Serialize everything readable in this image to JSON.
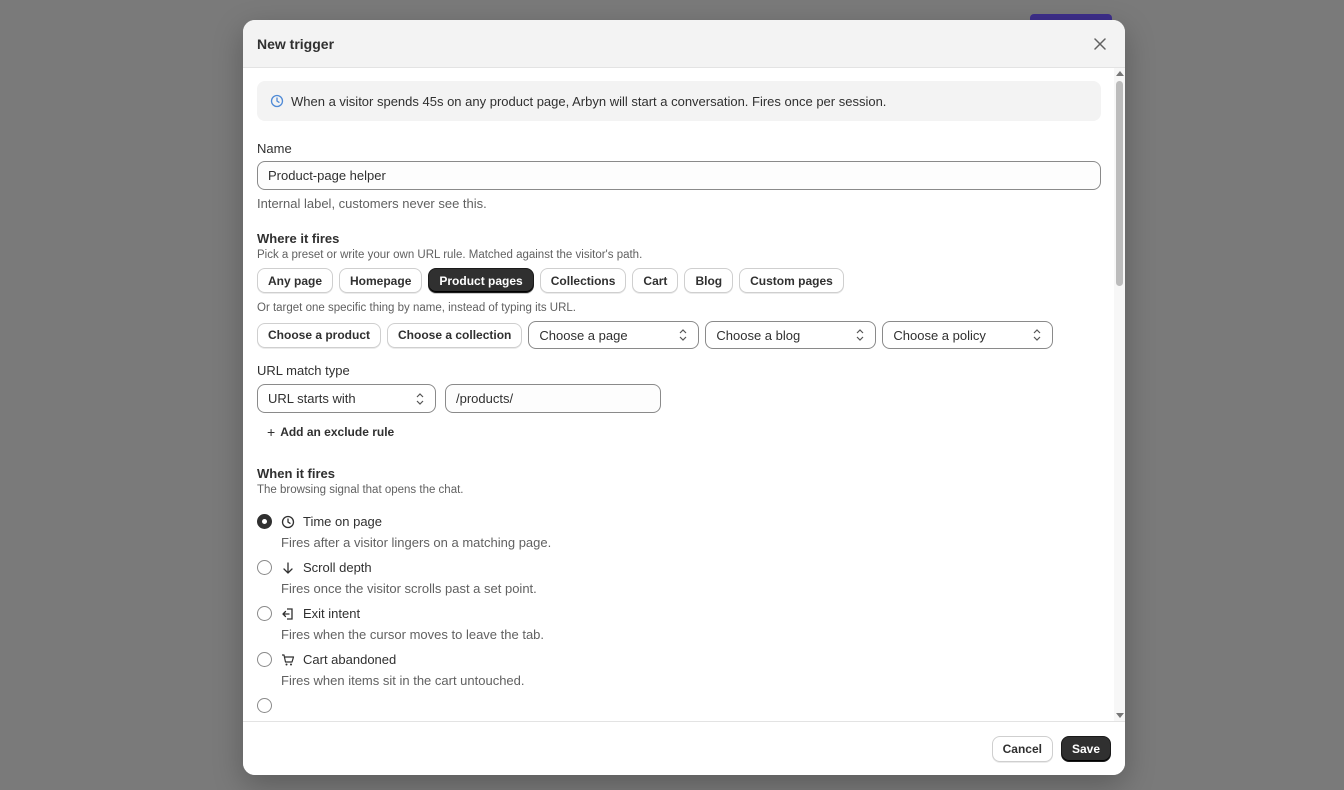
{
  "modal": {
    "title": "New trigger",
    "banner_text": "When a visitor spends 45s on any product page, Arbyn will start a conversation. Fires once per session."
  },
  "name_field": {
    "label": "Name",
    "value": "Product-page helper",
    "help": "Internal label, customers never see this."
  },
  "where": {
    "title": "Where it fires",
    "subtitle": "Pick a preset or write your own URL rule. Matched against the visitor's path.",
    "presets": [
      {
        "label": "Any page",
        "active": false
      },
      {
        "label": "Homepage",
        "active": false
      },
      {
        "label": "Product pages",
        "active": true
      },
      {
        "label": "Collections",
        "active": false
      },
      {
        "label": "Cart",
        "active": false
      },
      {
        "label": "Blog",
        "active": false
      },
      {
        "label": "Custom pages",
        "active": false
      }
    ],
    "specific_help": "Or target one specific thing by name, instead of typing its URL.",
    "choose_product": "Choose a product",
    "choose_collection": "Choose a collection",
    "choose_page": "Choose a page",
    "choose_blog": "Choose a blog",
    "choose_policy": "Choose a policy",
    "url_match_label": "URL match type",
    "url_match_value": "URL starts with",
    "url_value": "/products/",
    "add_exclude": "Add an exclude rule"
  },
  "when": {
    "title": "When it fires",
    "subtitle": "The browsing signal that opens the chat.",
    "options": [
      {
        "label": "Time on page",
        "desc": "Fires after a visitor lingers on a matching page.",
        "icon": "clock-icon",
        "checked": true
      },
      {
        "label": "Scroll depth",
        "desc": "Fires once the visitor scrolls past a set point.",
        "icon": "arrow-down-icon",
        "checked": false
      },
      {
        "label": "Exit intent",
        "desc": "Fires when the cursor moves to leave the tab.",
        "icon": "exit-icon",
        "checked": false
      },
      {
        "label": "Cart abandoned",
        "desc": "Fires when items sit in the cart untouched.",
        "icon": "cart-icon",
        "checked": false
      }
    ]
  },
  "footer": {
    "cancel": "Cancel",
    "save": "Save"
  }
}
